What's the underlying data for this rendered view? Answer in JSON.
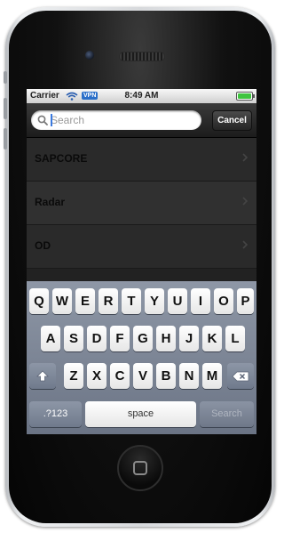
{
  "status_bar": {
    "carrier": "Carrier",
    "vpn": "VPN",
    "time": "8:49 AM",
    "battery_level": 1.0
  },
  "search": {
    "placeholder": "Search",
    "value": "",
    "cancel_label": "Cancel"
  },
  "list": {
    "items": [
      {
        "label": "SAPCORE"
      },
      {
        "label": "Radar"
      },
      {
        "label": "OD"
      }
    ]
  },
  "keyboard": {
    "row1": [
      "Q",
      "W",
      "E",
      "R",
      "T",
      "Y",
      "U",
      "I",
      "O",
      "P"
    ],
    "row2": [
      "A",
      "S",
      "D",
      "F",
      "G",
      "H",
      "J",
      "K",
      "L"
    ],
    "row3": [
      "Z",
      "X",
      "C",
      "V",
      "B",
      "N",
      "M"
    ],
    "num_label": ".?123",
    "space_label": "space",
    "search_label": "Search"
  },
  "colors": {
    "vpn_badge": "#2a6fc9",
    "battery_fill": "#3ec43e",
    "cursor": "#3b7ae0"
  }
}
